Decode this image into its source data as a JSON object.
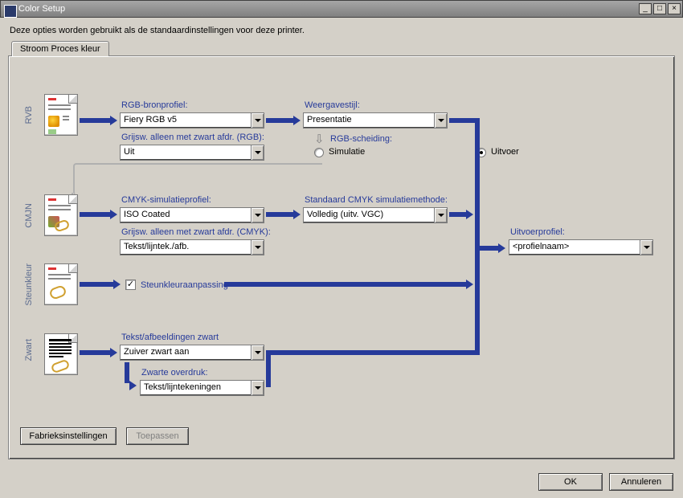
{
  "window": {
    "title": "Color Setup"
  },
  "description": "Deze opties worden gebruikt als de standaardinstellingen voor deze printer.",
  "tab": {
    "label": "Stroom Proces kleur"
  },
  "sections": {
    "rvb": {
      "label": "RVB"
    },
    "cmjn": {
      "label": "CMJN"
    },
    "steunkleur": {
      "label": "Steunkleur"
    },
    "zwart": {
      "label": "Zwart"
    }
  },
  "labels": {
    "rgb_bron": "RGB-bronprofiel:",
    "weergave": "Weergavestijl:",
    "grijs_rgb": "Grijsw. alleen met zwart afdr. (RGB):",
    "rgb_scheiding": "RGB-scheiding:",
    "simulatie": "Simulatie",
    "uitvoer": "Uitvoer",
    "cmyk_sim": "CMYK-simulatieprofiel:",
    "cmyk_method": "Standaard CMYK simulatiemethode:",
    "grijs_cmyk": "Grijsw. alleen met zwart afdr. (CMYK):",
    "uitvoerprofiel": "Uitvoerprofiel:",
    "steun_check": "Steunkleuraanpassing",
    "tekst_zwart": "Tekst/afbeeldingen zwart",
    "zwarte_overdruk": "Zwarte overdruk:"
  },
  "values": {
    "rgb_bron": "Fiery RGB v5",
    "weergave": "Presentatie",
    "grijs_rgb": "Uit",
    "cmyk_sim": "ISO Coated",
    "cmyk_method": "Volledig (uitv. VGC)",
    "grijs_cmyk": "Tekst/lijntek./afb.",
    "uitvoerprofiel": "<profielnaam>",
    "tekst_zwart": "Zuiver zwart aan",
    "zwarte_overdruk": "Tekst/lijntekeningen"
  },
  "buttons": {
    "fabriek": "Fabrieksinstellingen",
    "toepassen": "Toepassen",
    "ok": "OK",
    "annuleren": "Annuleren"
  },
  "winbtns": {
    "min": "_",
    "max": "□",
    "close": "×"
  }
}
